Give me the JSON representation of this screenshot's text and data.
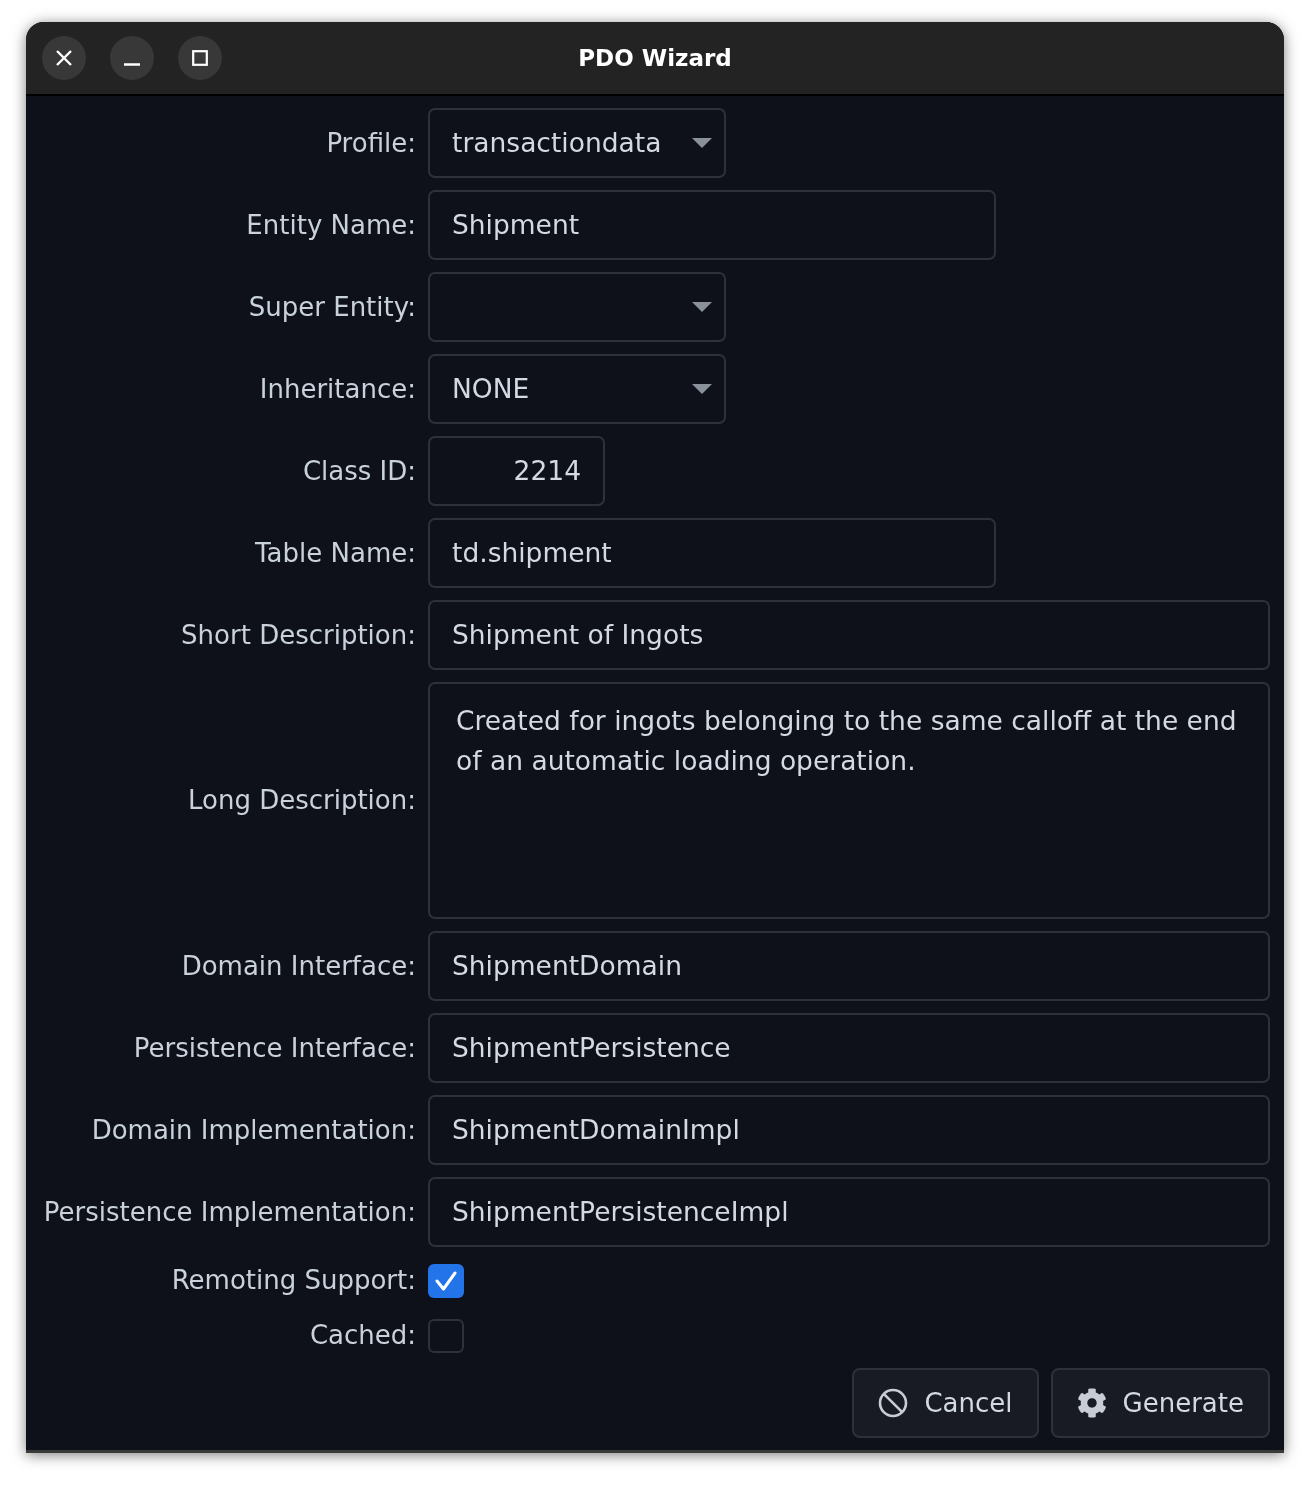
{
  "window": {
    "title": "PDO Wizard"
  },
  "fields": [
    {
      "label": "Profile:",
      "kind": "dropdown",
      "value": "transactiondata"
    },
    {
      "label": "Entity Name:",
      "kind": "text",
      "value": "Shipment"
    },
    {
      "label": "Super Entity:",
      "kind": "dropdown"
    },
    {
      "label": "Inheritance:",
      "kind": "dropdown",
      "value": "NONE"
    },
    {
      "label": "Class ID:",
      "kind": "number",
      "value": "2214"
    },
    {
      "label": "Table Name:",
      "kind": "text",
      "value": "td.shipment"
    },
    {
      "label": "Short Description:",
      "kind": "text",
      "value": "Shipment of Ingots"
    },
    {
      "label": "Long Description:",
      "kind": "textarea",
      "value": "Created for ingots belonging to the same calloff at the end of an automatic loading operation."
    },
    {
      "label": "Domain Interface:",
      "kind": "text",
      "value": "ShipmentDomain"
    },
    {
      "label": "Persistence Interface:",
      "kind": "text",
      "value": "ShipmentPersistence"
    },
    {
      "label": "Domain Implementation:",
      "kind": "text",
      "value": "ShipmentDomainImpl"
    },
    {
      "label": "Persistence Implementation:",
      "kind": "text",
      "value": "ShipmentPersistenceImpl"
    }
  ],
  "options": [
    {
      "label": "Remoting Support:",
      "checked": true
    },
    {
      "label": "Cached:",
      "checked": false
    }
  ],
  "buttons": [
    {
      "label": "Cancel",
      "kind": "cancel"
    },
    {
      "label": "Generate",
      "kind": "generate"
    }
  ]
}
